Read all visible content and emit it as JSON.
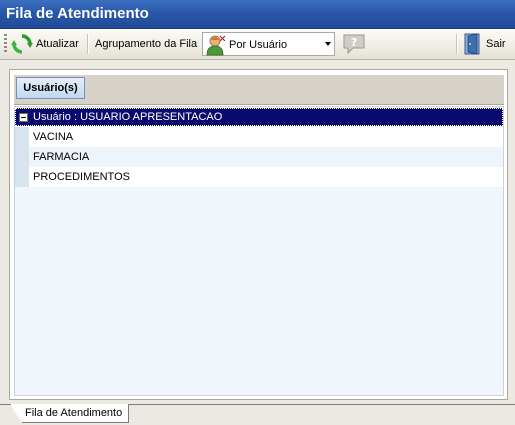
{
  "window": {
    "title": "Fila de Atendimento"
  },
  "toolbar": {
    "refresh_label": "Atualizar",
    "group_label": "Agrupamento da Fila",
    "group_select_value": "Por Usuário",
    "exit_label": "Sair"
  },
  "group_panel": {
    "chip_label": "Usuário(s)"
  },
  "grid": {
    "group_row": "Usuário : USUARIO APRESENTACAO",
    "rows": [
      "VACINA",
      "FARMACIA",
      "PROCEDIMENTOS"
    ]
  },
  "bottom_tab": {
    "label": "Fila de Atendimento"
  },
  "icons": {
    "refresh": "refresh-arrows-icon",
    "user": "user-person-icon",
    "help": "help-speech-bubble-icon",
    "exit": "exit-door-icon"
  },
  "colors": {
    "titlebar": "#2a58a8",
    "selected_group_row": "#0a0a6e",
    "chip": "#c3d7f2"
  }
}
